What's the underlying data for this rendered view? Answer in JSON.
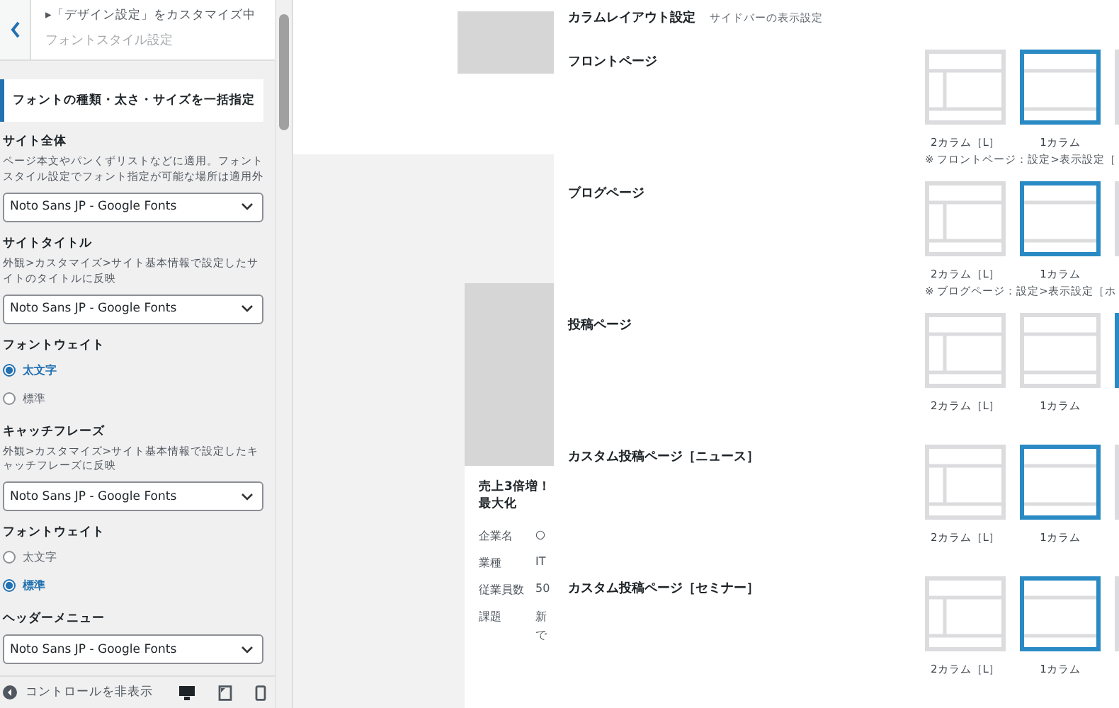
{
  "sidebar": {
    "breadcrumb": "▸「デザイン設定」をカスタマイズ中",
    "title": "フォントスタイル設定",
    "section_heading": "フォントの種類・太さ・サイズを一括指定",
    "groups": [
      {
        "kind": "select",
        "label": "サイト全体",
        "description": "ページ本文やパンくずリストなどに適用。フォントスタイル設定でフォント指定が可能な場所は適用外",
        "value": "Noto Sans JP - Google Fonts"
      },
      {
        "kind": "select",
        "label": "サイトタイトル",
        "description": "外観>カスタマイズ>サイト基本情報で設定したサイトのタイトルに反映",
        "value": "Noto Sans JP - Google Fonts"
      },
      {
        "kind": "radio",
        "label": "フォントウェイト",
        "options": [
          {
            "label": "太文字",
            "selected": true
          },
          {
            "label": "標準",
            "selected": false
          }
        ]
      },
      {
        "kind": "select",
        "label": "キャッチフレーズ",
        "description": "外観>カスタマイズ>サイト基本情報で設定したキャッチフレーズに反映",
        "value": "Noto Sans JP - Google Fonts"
      },
      {
        "kind": "radio",
        "label": "フォントウェイト",
        "options": [
          {
            "label": "太文字",
            "selected": false
          },
          {
            "label": "標準",
            "selected": true
          }
        ]
      },
      {
        "kind": "select",
        "label": "ヘッダーメニュー",
        "value": "Noto Sans JP - Google Fonts"
      }
    ],
    "footer": {
      "label": "コントロールを非表示"
    }
  },
  "preview": {
    "card": {
      "title": [
        "売上3倍増！",
        "最大化"
      ],
      "rows": [
        {
          "key": "企業名",
          "value": "○"
        },
        {
          "key": "業種",
          "value": "IT"
        },
        {
          "key": "従業員数",
          "value": "50"
        },
        {
          "key": "課題",
          "value": "新",
          "value_2": "で"
        }
      ]
    }
  },
  "layout_panel": {
    "title": "カラムレイアウト設定",
    "subtitle": "サイドバーの表示設定",
    "rows": [
      {
        "label": "フロントページ",
        "options": [
          {
            "kind": "two-column",
            "label": "2カラム［L］",
            "selected": false
          },
          {
            "kind": "one-column",
            "label": "1カラム",
            "selected": true
          },
          {
            "selected": false
          }
        ],
        "note": "※ フロントページ：設定>表示設定［"
      },
      {
        "label": "ブログページ",
        "options": [
          {
            "kind": "two-column",
            "label": "2カラム［L］",
            "selected": false
          },
          {
            "kind": "one-column",
            "label": "1カラム",
            "selected": true
          },
          {
            "selected": false
          }
        ],
        "note": "※ ブログページ：設定>表示設定［ホ"
      },
      {
        "label": "投稿ページ",
        "options": [
          {
            "kind": "two-column",
            "label": "2カラム［L］",
            "selected": false
          },
          {
            "kind": "one-column",
            "label": "1カラム",
            "selected": false
          },
          {
            "selected": true
          }
        ]
      },
      {
        "label": "カスタム投稿ページ［ニュース］",
        "options": [
          {
            "kind": "two-column",
            "label": "2カラム［L］",
            "selected": false
          },
          {
            "kind": "one-column",
            "label": "1カラム",
            "selected": true
          },
          {
            "selected": false
          }
        ]
      },
      {
        "label": "カスタム投稿ページ［セミナー］",
        "options": [
          {
            "kind": "two-column",
            "label": "2カラム［L］",
            "selected": false
          },
          {
            "kind": "one-column",
            "label": "1カラム",
            "selected": true
          },
          {
            "selected": false
          }
        ]
      }
    ]
  }
}
